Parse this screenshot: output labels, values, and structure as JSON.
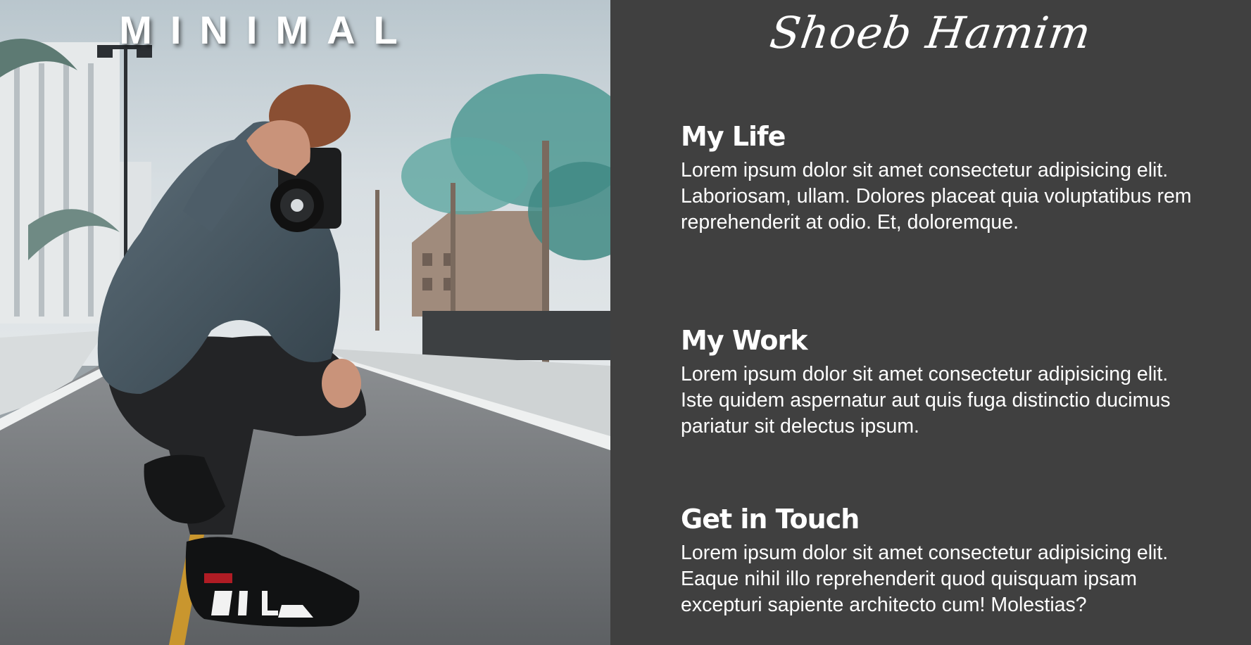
{
  "hero": {
    "title": "MINIMAL",
    "image": {
      "description_icon": "photographer-photo",
      "colors": {
        "sky": "#c9d3d8",
        "road": "#6f7275",
        "jacket": "#4f5f69",
        "trees": "#3f8f88"
      }
    }
  },
  "content": {
    "signature": "Shoeb Hamim",
    "background": "#404040",
    "sections": [
      {
        "heading": "My Life",
        "body": "Lorem ipsum dolor sit amet consectetur adipisicing elit. Laboriosam, ullam. Dolores placeat quia voluptatibus rem reprehenderit at odio. Et, doloremque."
      },
      {
        "heading": "My Work",
        "body": "Lorem ipsum dolor sit amet consectetur adipisicing elit. Iste quidem aspernatur aut quis fuga distinctio ducimus pariatur sit delectus ipsum."
      },
      {
        "heading": "Get in Touch",
        "body": "Lorem ipsum dolor sit amet consectetur adipisicing elit. Eaque nihil illo reprehenderit quod quisquam ipsam excepturi sapiente architecto cum! Molestias?"
      }
    ]
  }
}
